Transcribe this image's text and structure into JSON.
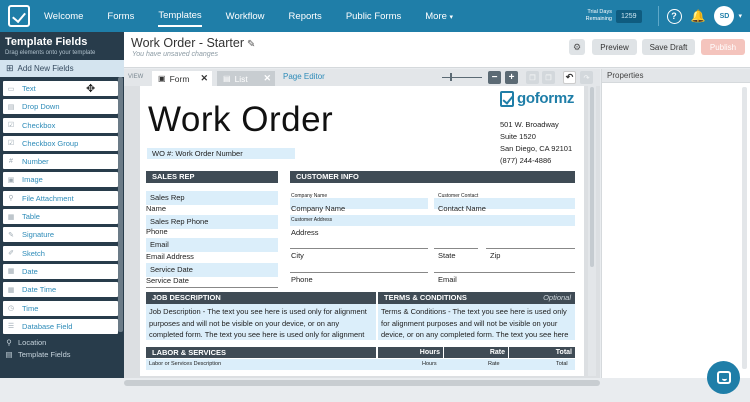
{
  "nav": {
    "items": [
      "Welcome",
      "Forms",
      "Templates",
      "Workflow",
      "Reports",
      "Public Forms",
      "More"
    ],
    "trial_line1": "Trial Days",
    "trial_line2": "Remaining",
    "trial_count": "1259",
    "help_icon": "question-circle-icon",
    "bell_icon": "bell-icon",
    "avatar_initials": "SD"
  },
  "left_panel": {
    "title": "Template Fields",
    "subtitle": "Drag elements onto your template",
    "add_new": "Add New Fields",
    "fields": [
      {
        "label": "Text",
        "icon": "text-field-icon",
        "glyph": "▭"
      },
      {
        "label": "Drop Down",
        "icon": "dropdown-icon",
        "glyph": "▤"
      },
      {
        "label": "Checkbox",
        "icon": "checkbox-icon",
        "glyph": "☑"
      },
      {
        "label": "Checkbox Group",
        "icon": "checkbox-group-icon",
        "glyph": "☑"
      },
      {
        "label": "Number",
        "icon": "number-icon",
        "glyph": "#"
      },
      {
        "label": "Image",
        "icon": "image-icon",
        "glyph": "▣"
      },
      {
        "label": "File Attachment",
        "icon": "paperclip-icon",
        "glyph": "⚲"
      },
      {
        "label": "Table",
        "icon": "table-icon",
        "glyph": "▦"
      },
      {
        "label": "Signature",
        "icon": "signature-icon",
        "glyph": "✎"
      },
      {
        "label": "Sketch",
        "icon": "sketch-icon",
        "glyph": "✐"
      },
      {
        "label": "Date",
        "icon": "calendar-icon",
        "glyph": "▦"
      },
      {
        "label": "Date Time",
        "icon": "calendar-clock-icon",
        "glyph": "▦"
      },
      {
        "label": "Time",
        "icon": "clock-icon",
        "glyph": "◷"
      },
      {
        "label": "Database Field",
        "icon": "database-icon",
        "glyph": "☰"
      }
    ],
    "location": "Location",
    "template_fields": "Template Fields"
  },
  "header": {
    "title": "Work Order - Starter",
    "unsaved": "You have unsaved changes",
    "preview": "Preview",
    "save_draft": "Save Draft",
    "publish": "Publish"
  },
  "toolbar": {
    "view": "VIEW",
    "tab_form": "Form",
    "tab_list": "List",
    "page_editor": "Page Editor"
  },
  "form": {
    "heading": "Work Order",
    "wo_number": "WO #: Work Order Number",
    "logo_text": "goformz",
    "address": [
      "501 W. Broadway",
      "Suite 1520",
      "San Diego, CA 92101",
      "(877) 244-4886"
    ],
    "sales_rep_head": "SALES REP",
    "customer_info_head": "CUSTOMER INFO",
    "sales_rep_field": "Sales Rep",
    "name_label": "Name",
    "sales_rep_phone_field": "Sales Rep Phone",
    "phone_label": "Phone",
    "email_field": "Email",
    "email_address_label": "Email Address",
    "service_date_field": "Service Date",
    "service_date_label": "Service Date",
    "company_name_tiny": "Company Name",
    "company_name_field": "Company Name",
    "customer_contact_tiny": "Customer Contact",
    "contact_name_field": "Contact Name",
    "customer_address_tiny": "Customer Address",
    "address_field": "Address",
    "city": "City",
    "state": "State",
    "zip": "Zip",
    "phone": "Phone",
    "email": "Email",
    "job_desc_head": "JOB DESCRIPTION",
    "terms_head": "TERMS & CONDITIONS",
    "optional": "Optional",
    "job_desc_text": "Job Description - The text you see here is used only for alignment purposes and will not be visible on your device, or on any completed form. The text you see here is used only for alignment",
    "terms_text": "Terms & Conditions - The text you see here is used only for alignment purposes and will not be visible on your device, or on any completed form. The text you see here is used only for alignment",
    "labor_head": "LABOR & SERVICES",
    "hours_head": "Hours",
    "rate_head": "Rate",
    "total_head": "Total",
    "row_desc": "Labor or Services Description",
    "row_hours": "Hours",
    "row_rate": "Rate",
    "row_total": "Total"
  },
  "properties": {
    "title": "Properties"
  },
  "colors": {
    "nav_blue": "#1f7ea8",
    "panel_dark": "#283c4b",
    "field_fill": "#dbeefa",
    "section_head": "#3f4b55"
  }
}
